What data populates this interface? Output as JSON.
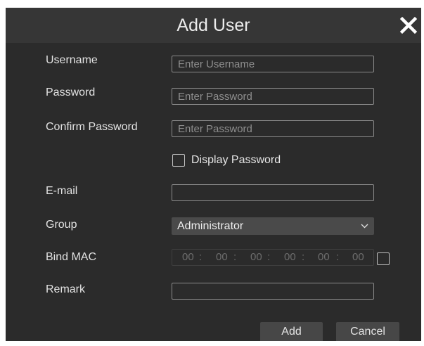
{
  "dialog": {
    "title": "Add User",
    "close_icon": "close-icon"
  },
  "form": {
    "username": {
      "label": "Username",
      "value": "",
      "placeholder": "Enter Username"
    },
    "password": {
      "label": "Password",
      "value": "",
      "placeholder": "Enter Password"
    },
    "confirm_password": {
      "label": "Confirm Password",
      "value": "",
      "placeholder": "Enter Password"
    },
    "display_password": {
      "label": "Display Password",
      "checked": false
    },
    "email": {
      "label": "E-mail",
      "value": ""
    },
    "group": {
      "label": "Group",
      "selected": "Administrator",
      "icon": "chevron-down-icon"
    },
    "bind_mac": {
      "label": "Bind MAC",
      "octets": [
        "00",
        "00",
        "00",
        "00",
        "00",
        "00"
      ],
      "separator": ":",
      "enabled": false
    },
    "remark": {
      "label": "Remark",
      "value": ""
    }
  },
  "buttons": {
    "add": "Add",
    "cancel": "Cancel"
  },
  "colors": {
    "dialog_bg": "#2b2b2b",
    "titlebar_bg": "#363636",
    "button_bg": "#474747",
    "select_bg": "#4a4a4a"
  }
}
